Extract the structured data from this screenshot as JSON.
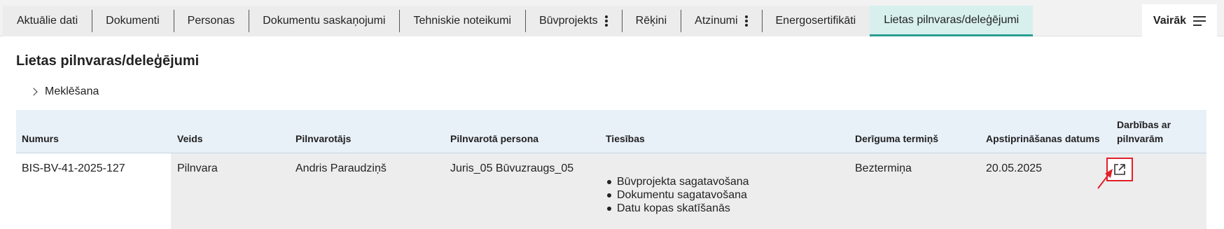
{
  "tabs": [
    {
      "label": "Aktuālie dati",
      "menu": false,
      "active": false
    },
    {
      "label": "Dokumenti",
      "menu": false,
      "active": false
    },
    {
      "label": "Personas",
      "menu": false,
      "active": false
    },
    {
      "label": "Dokumentu saskaņojumi",
      "menu": false,
      "active": false
    },
    {
      "label": "Tehniskie noteikumi",
      "menu": false,
      "active": false
    },
    {
      "label": "Būvprojekts",
      "menu": true,
      "active": false
    },
    {
      "label": "Rēķini",
      "menu": false,
      "active": false
    },
    {
      "label": "Atzinumi",
      "menu": true,
      "active": false
    },
    {
      "label": "Energosertifikāti",
      "menu": false,
      "active": false
    },
    {
      "label": "Lietas pilnvaras/deleģējumi",
      "menu": false,
      "active": true
    }
  ],
  "more": {
    "label": "Vairāk",
    "icon": "hamburger-menu-icon"
  },
  "page": {
    "title": "Lietas pilnvaras/deleģējumi",
    "search_label": "Meklēšana"
  },
  "table": {
    "headers": {
      "numurs": "Numurs",
      "veids": "Veids",
      "pilnvarotajs": "Pilnvarotājs",
      "pilnvarota_persona": "Pilnvarotā persona",
      "tiesibas": "Tiesības",
      "deriguma_termins": "Derīguma termiņš",
      "apstiprinasanas_datums": "Apstiprināšanas datums",
      "darbibas_line1": "Darbības ar",
      "darbibas_line2": "pilnvarām"
    },
    "rows": [
      {
        "numurs": "BIS-BV-41-2025-127",
        "veids": "Pilnvara",
        "pilnvarotajs": "Andris Paraudziņš",
        "pilnvarota_persona": "Juris_05 Būvuzraugs_05",
        "tiesibas": [
          "Būvprojekta sagatavošana",
          "Dokumentu sagatavošana",
          "Datu kopas skatīšanās"
        ],
        "deriguma_termins": "Beztermiņa",
        "apstiprinasanas_datums": "20.05.2025",
        "action_icon": "open-external-icon"
      }
    ]
  },
  "colors": {
    "active_tab_bg": "#d7f0ee",
    "active_tab_accent": "#2a9d8f",
    "header_bg": "#e8f0f8",
    "highlight": "#e0202a"
  }
}
